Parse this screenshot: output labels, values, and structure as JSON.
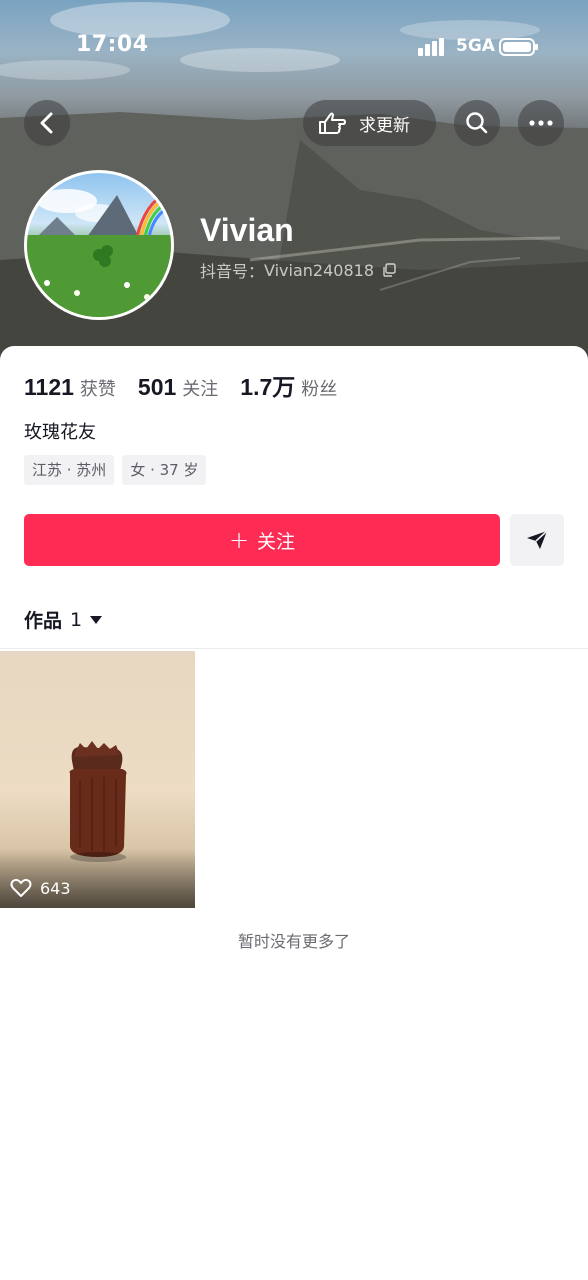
{
  "status_bar": {
    "time": "17:04",
    "network": "5GA"
  },
  "header": {
    "request_update_label": "求更新",
    "username": "Vivian",
    "douyin_id_label": "抖音号：",
    "douyin_id": "Vivian240818"
  },
  "stats": [
    {
      "value": "1121",
      "label": "获赞"
    },
    {
      "value": "501",
      "label": "关注"
    },
    {
      "value": "1.7万",
      "label": "粉丝"
    }
  ],
  "bio": "玫瑰花友",
  "tags": [
    "江苏 · 苏州",
    "女 · 37 岁"
  ],
  "actions": {
    "follow_label": "关注",
    "follow_plus": "+"
  },
  "works_tab": {
    "label": "作品",
    "count": "1"
  },
  "videos": [
    {
      "likes": "643"
    }
  ],
  "footer_text": "暂时没有更多了",
  "colors": {
    "accent": "#fe2c55",
    "text_primary": "#161823",
    "text_secondary": "#6b6b73"
  },
  "icons": [
    "back-icon",
    "pointing-hand-icon",
    "search-icon",
    "more-icon",
    "copy-icon",
    "share-arrow-icon",
    "caret-down-icon",
    "heart-icon"
  ]
}
